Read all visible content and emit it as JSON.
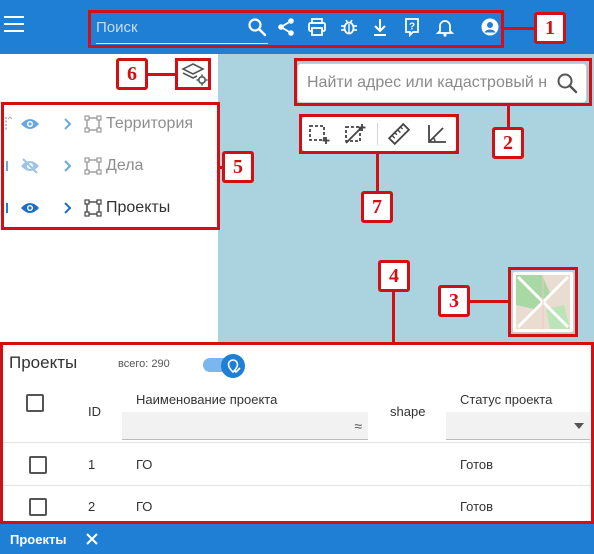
{
  "header": {
    "search_placeholder": "Поиск",
    "icons": [
      "menu-icon",
      "search-icon",
      "share-icon",
      "print-icon",
      "bug-icon",
      "download-icon",
      "help-icon",
      "bell-icon",
      "user-icon"
    ]
  },
  "map": {
    "address_search_placeholder": "Найти адрес или кадастровый н",
    "tools": [
      "select-rectangle-icon",
      "clear-selection-icon",
      "ruler-icon",
      "angle-measure-icon"
    ]
  },
  "layers": {
    "items": [
      {
        "label": "Территория",
        "visible": true
      },
      {
        "label": "Дела",
        "visible": false
      },
      {
        "label": "Проекты",
        "visible": true
      }
    ]
  },
  "table": {
    "title": "Проекты",
    "count": "всего: 290",
    "columns": [
      "ID",
      "Наименование проекта",
      "shape",
      "Статус проекта"
    ],
    "filter_symbol": "≈",
    "rows": [
      {
        "id": "1",
        "name": "ГО",
        "status": "Готов"
      },
      {
        "id": "2",
        "name": "ГО",
        "status": "Готов"
      }
    ]
  },
  "tabbar": {
    "tab_label": "Проекты"
  },
  "annotations": [
    "1",
    "2",
    "3",
    "4",
    "5",
    "6",
    "7"
  ],
  "colors": {
    "primary": "#1f7fd4",
    "annotation": "#d40f14",
    "map_water": "#aad3df"
  }
}
